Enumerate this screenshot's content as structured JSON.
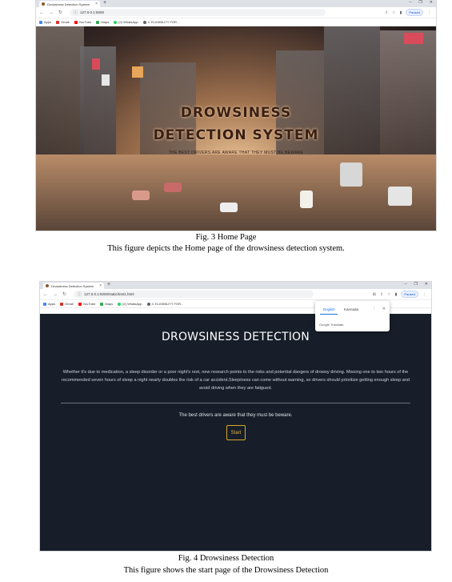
{
  "figure3": {
    "browser": {
      "tab_title": "Drowsiness Detection System",
      "tab_close": "×",
      "new_tab": "+",
      "window_controls": [
        "–",
        "❐",
        "✕"
      ],
      "url": "127.0.0.1:5000",
      "profile_label": "Paused",
      "bookmarks": [
        "Apps",
        "Gmail",
        "YouTube",
        "Maps",
        "(2) WhatsApp",
        "3. ELIGIBILITY FOR..."
      ]
    },
    "hero": {
      "title_line1": "DROWSINESS",
      "title_line2": "DETECTION SYSTEM",
      "subtitle": "THE BEST DRIVERS ARE AWARE THAT THEY MUST BE BEWARE"
    },
    "caption_title": "Fig. 3 Home Page",
    "caption_text": "This figure depicts the Home page of the drowsiness detection system."
  },
  "figure4": {
    "browser": {
      "tab_title": "Drowsiness Detection System",
      "tab_close": "×",
      "new_tab": "+",
      "window_controls": [
        "–",
        "❐",
        "✕"
      ],
      "url": "127.0.0.1:5000/static/test1.html",
      "profile_label": "Paused",
      "bookmarks": [
        "Apps",
        "Gmail",
        "YouTube",
        "Maps",
        "(2) WhatsApp",
        "3. ELIGIBILITY FOR..."
      ]
    },
    "translate_popup": {
      "lang1": "English",
      "lang2": "Kannada",
      "footer": "Google Translate"
    },
    "page": {
      "title": "DROWSINESS DETECTION",
      "paragraph": "Whether it's due to medication, a sleep disorder or a poor night's rest, new research points to the risks and potential dangers of drowsy driving. Missing one to two hours of the recommended seven hours of sleep a night nearly doubles the risk of a car accident.Sleepiness can come without warning, so drivers should prioritize getting enough sleep and avoid driving when they are fatigued.",
      "tagline": "The best drivers are aware that they must be beware.",
      "start_button": "Start"
    },
    "caption_title": "Fig. 4 Drowsiness Detection",
    "caption_text": "This figure shows the start page of the Drowsiness Detection"
  },
  "colors": {
    "dark_bg": "#171e2a",
    "start_accent": "#d9a72b",
    "link_blue": "#1a73e8"
  }
}
